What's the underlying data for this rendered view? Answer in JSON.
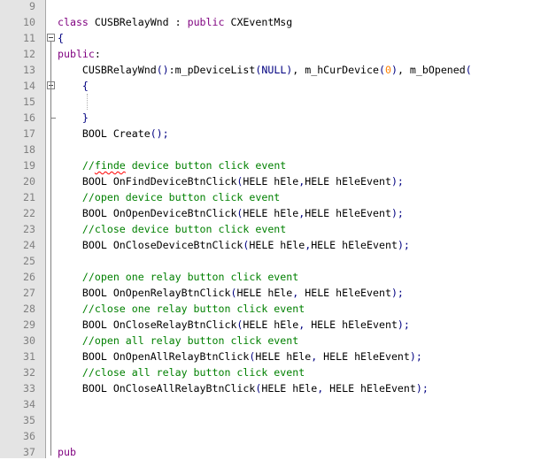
{
  "editor": {
    "lines": [
      {
        "n": "9",
        "segs": []
      },
      {
        "n": "10",
        "segs": [
          {
            "t": "class",
            "c": "kw"
          },
          {
            "t": " CUSBRelayWnd : "
          },
          {
            "t": "public",
            "c": "kw"
          },
          {
            "t": " CXEventMsg"
          }
        ]
      },
      {
        "n": "11",
        "segs": [
          {
            "t": "{",
            "c": "op"
          }
        ],
        "fold": "box"
      },
      {
        "n": "12",
        "segs": [
          {
            "t": "public",
            "c": "kw"
          },
          {
            "t": ":"
          }
        ]
      },
      {
        "n": "13",
        "segs": [
          {
            "t": "    CUSBRelayWnd"
          },
          {
            "t": "()",
            "c": "op"
          },
          {
            "t": ":m_pDeviceList"
          },
          {
            "t": "(",
            "c": "op"
          },
          {
            "t": "NULL",
            "c": "op"
          },
          {
            "t": ")",
            "c": "op"
          },
          {
            "t": ", m_hCurDevice"
          },
          {
            "t": "(",
            "c": "op"
          },
          {
            "t": "0",
            "c": "num"
          },
          {
            "t": ")",
            "c": "op"
          },
          {
            "t": ", m_bOpened"
          },
          {
            "t": "(",
            "c": "op"
          }
        ]
      },
      {
        "n": "14",
        "segs": [
          {
            "t": "    "
          },
          {
            "t": "{",
            "c": "op"
          }
        ],
        "fold": "box"
      },
      {
        "n": "15",
        "segs": []
      },
      {
        "n": "16",
        "segs": [
          {
            "t": "    "
          },
          {
            "t": "}",
            "c": "op"
          }
        ],
        "fold": "end"
      },
      {
        "n": "17",
        "segs": [
          {
            "t": "    BOOL Create"
          },
          {
            "t": "();",
            "c": "op"
          }
        ]
      },
      {
        "n": "18",
        "segs": []
      },
      {
        "n": "19",
        "segs": [
          {
            "t": "    //",
            "c": "cm"
          },
          {
            "t": "finde",
            "c": "cm",
            "sq": true
          },
          {
            "t": " device button click event",
            "c": "cm"
          }
        ]
      },
      {
        "n": "20",
        "segs": [
          {
            "t": "    BOOL OnFindDeviceBtnClick"
          },
          {
            "t": "(",
            "c": "op"
          },
          {
            "t": "HELE hEle"
          },
          {
            "t": ",",
            "c": "op"
          },
          {
            "t": "HELE hEleEvent"
          },
          {
            "t": ");",
            "c": "op"
          }
        ]
      },
      {
        "n": "21",
        "segs": [
          {
            "t": "    //open device button click event",
            "c": "cm"
          }
        ]
      },
      {
        "n": "22",
        "segs": [
          {
            "t": "    BOOL OnOpenDeviceBtnClick"
          },
          {
            "t": "(",
            "c": "op"
          },
          {
            "t": "HELE hEle"
          },
          {
            "t": ",",
            "c": "op"
          },
          {
            "t": "HELE hEleEvent"
          },
          {
            "t": ");",
            "c": "op"
          }
        ]
      },
      {
        "n": "23",
        "segs": [
          {
            "t": "    //close device button click event",
            "c": "cm"
          }
        ]
      },
      {
        "n": "24",
        "segs": [
          {
            "t": "    BOOL OnCloseDeviceBtnClick"
          },
          {
            "t": "(",
            "c": "op"
          },
          {
            "t": "HELE hEle"
          },
          {
            "t": ",",
            "c": "op"
          },
          {
            "t": "HELE hEleEvent"
          },
          {
            "t": ");",
            "c": "op"
          }
        ]
      },
      {
        "n": "25",
        "segs": []
      },
      {
        "n": "26",
        "segs": [
          {
            "t": "    //open one relay button click event",
            "c": "cm"
          }
        ]
      },
      {
        "n": "27",
        "segs": [
          {
            "t": "    BOOL OnOpenRelayBtnClick"
          },
          {
            "t": "(",
            "c": "op"
          },
          {
            "t": "HELE hEle"
          },
          {
            "t": ",",
            "c": "op"
          },
          {
            "t": " HELE hEleEvent"
          },
          {
            "t": ");",
            "c": "op"
          }
        ]
      },
      {
        "n": "28",
        "segs": [
          {
            "t": "    //close one relay button click event",
            "c": "cm"
          }
        ]
      },
      {
        "n": "29",
        "segs": [
          {
            "t": "    BOOL OnCloseRelayBtnClick"
          },
          {
            "t": "(",
            "c": "op"
          },
          {
            "t": "HELE hEle"
          },
          {
            "t": ",",
            "c": "op"
          },
          {
            "t": " HELE hEleEvent"
          },
          {
            "t": ");",
            "c": "op"
          }
        ]
      },
      {
        "n": "30",
        "segs": [
          {
            "t": "    //open all relay button click event",
            "c": "cm"
          }
        ]
      },
      {
        "n": "31",
        "segs": [
          {
            "t": "    BOOL OnOpenAllRelayBtnClick"
          },
          {
            "t": "(",
            "c": "op"
          },
          {
            "t": "HELE hEle"
          },
          {
            "t": ",",
            "c": "op"
          },
          {
            "t": " HELE hEleEvent"
          },
          {
            "t": ");",
            "c": "op"
          }
        ]
      },
      {
        "n": "32",
        "segs": [
          {
            "t": "    //close all relay button click event",
            "c": "cm"
          }
        ]
      },
      {
        "n": "33",
        "segs": [
          {
            "t": "    BOOL OnCloseAllRelayBtnClick"
          },
          {
            "t": "(",
            "c": "op"
          },
          {
            "t": "HELE hEle"
          },
          {
            "t": ",",
            "c": "op"
          },
          {
            "t": " HELE hEleEvent"
          },
          {
            "t": ");",
            "c": "op"
          }
        ]
      },
      {
        "n": "34",
        "segs": []
      },
      {
        "n": "35",
        "segs": []
      },
      {
        "n": "36",
        "segs": []
      },
      {
        "n": "37",
        "segs": [
          {
            "t": "pub",
            "c": "kw"
          }
        ]
      }
    ]
  }
}
